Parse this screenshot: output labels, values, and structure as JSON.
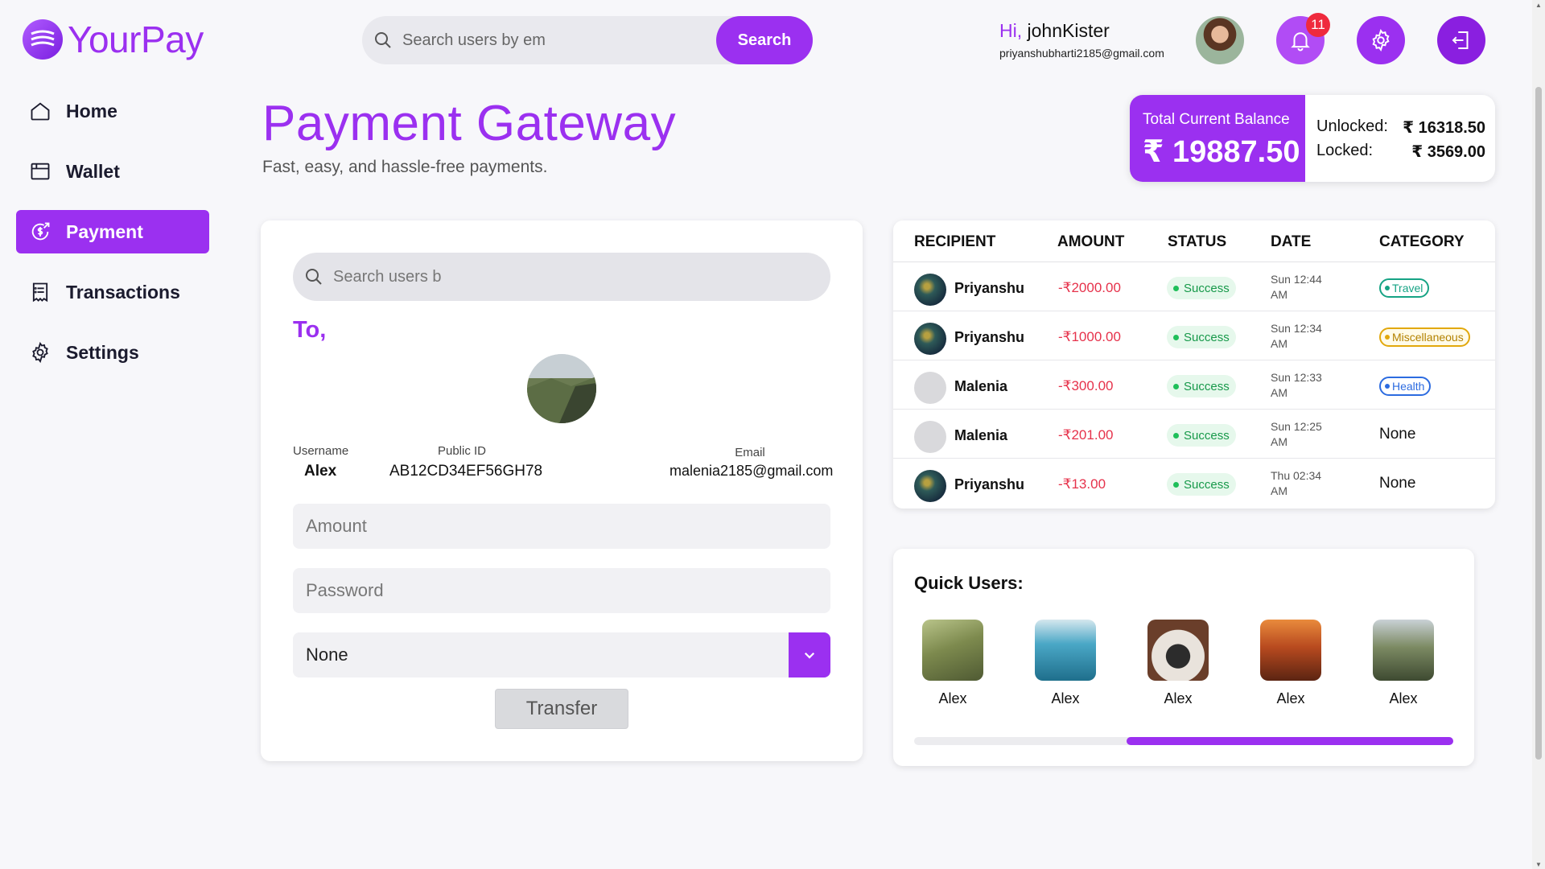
{
  "app": {
    "name": "YourPay"
  },
  "header": {
    "search_placeholder": "Search users by em",
    "search_button": "Search",
    "greeting": "Hi,",
    "username": "johnKister",
    "email": "priyanshubharti2185@gmail.com",
    "notification_count": "11"
  },
  "sidebar": {
    "items": [
      {
        "label": "Home",
        "icon": "home-icon"
      },
      {
        "label": "Wallet",
        "icon": "wallet-icon"
      },
      {
        "label": "Payment",
        "icon": "payment-icon",
        "active": true
      },
      {
        "label": "Transactions",
        "icon": "receipt-icon"
      },
      {
        "label": "Settings",
        "icon": "gear-icon"
      }
    ]
  },
  "page": {
    "title": "Payment Gateway",
    "subtitle": "Fast, easy, and hassle-free payments."
  },
  "balance": {
    "total_label": "Total Current Balance",
    "total_value": "₹ 19887.50",
    "unlocked_label": "Unlocked:",
    "unlocked_value": "₹ 16318.50",
    "locked_label": "Locked:",
    "locked_value": "₹ 3569.00"
  },
  "payment_form": {
    "search_placeholder": "Search users b",
    "to_label": "To,",
    "username_label": "Username",
    "username_value": "Alex",
    "public_id_label": "Public ID",
    "public_id_value": "AB12CD34EF56GH78",
    "email_label": "Email",
    "email_value": "malenia2185@gmail.com",
    "amount_placeholder": "Amount",
    "password_placeholder": "Password",
    "category_selected": "None",
    "transfer_button": "Transfer"
  },
  "transactions": {
    "headers": [
      "RECIPIENT",
      "AMOUNT",
      "STATUS",
      "DATE",
      "CATEGORY"
    ],
    "rows": [
      {
        "recipient": "Priyanshu",
        "amount": "-₹2000.00",
        "status": "Success",
        "date": "Sun 12:44 AM",
        "category": "Travel"
      },
      {
        "recipient": "Priyanshu",
        "amount": "-₹1000.00",
        "status": "Success",
        "date": "Sun 12:34 AM",
        "category": "Miscellaneous"
      },
      {
        "recipient": "Malenia",
        "amount": "-₹300.00",
        "status": "Success",
        "date": "Sun 12:33 AM",
        "category": "Health"
      },
      {
        "recipient": "Malenia",
        "amount": "-₹201.00",
        "status": "Success",
        "date": "Sun 12:25 AM",
        "category": "None"
      },
      {
        "recipient": "Priyanshu",
        "amount": "-₹13.00",
        "status": "Success",
        "date": "Thu 02:34 AM",
        "category": "None"
      }
    ]
  },
  "quick_users": {
    "title": "Quick Users:",
    "users": [
      {
        "name": "Alex"
      },
      {
        "name": "Alex"
      },
      {
        "name": "Alex"
      },
      {
        "name": "Alex"
      },
      {
        "name": "Alex"
      }
    ]
  },
  "colors": {
    "accent": "#9b30f0",
    "negative": "#e6324b",
    "success": "#17994a"
  }
}
